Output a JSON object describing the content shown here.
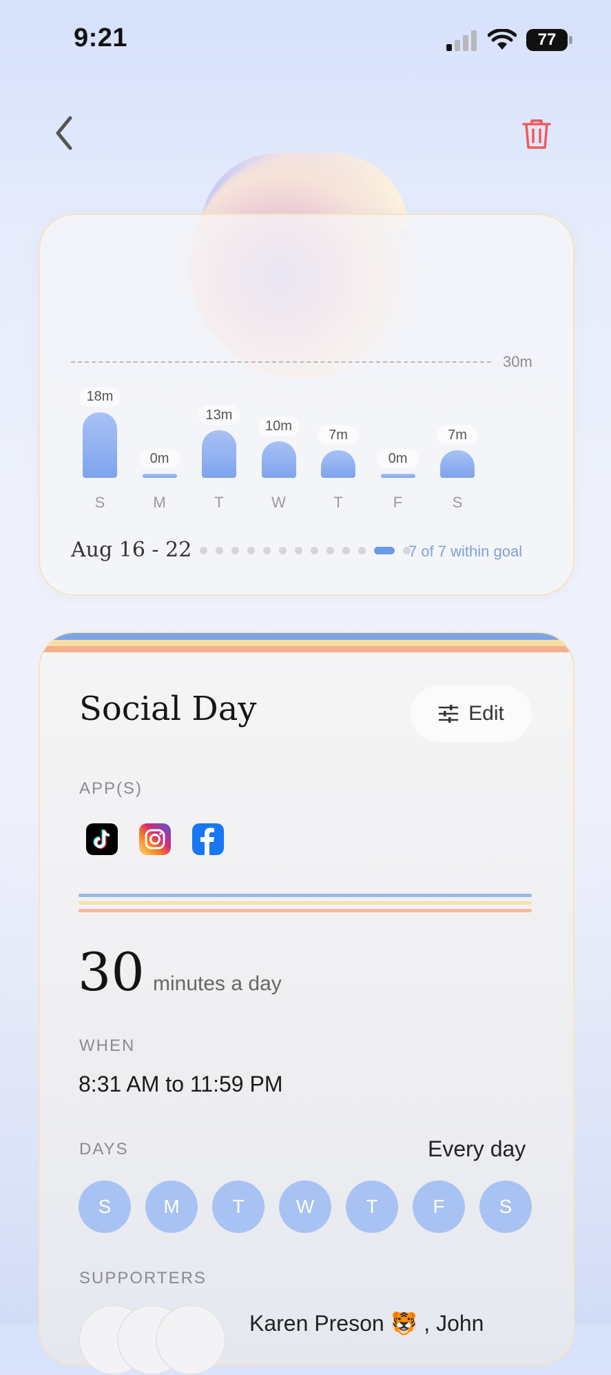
{
  "status_bar": {
    "time": "9:21",
    "battery": "77"
  },
  "chart_data": {
    "type": "bar",
    "categories": [
      "S",
      "M",
      "T",
      "W",
      "T",
      "F",
      "S"
    ],
    "values": [
      18,
      0,
      13,
      10,
      7,
      0,
      7
    ],
    "value_labels": [
      "18m",
      "0m",
      "13m",
      "10m",
      "7m",
      "0m",
      "7m"
    ],
    "goal_label": "30m",
    "goal_value": 30,
    "ylim": [
      0,
      30
    ]
  },
  "week": {
    "range": "Aug 16 - 22",
    "within_goal": "7 of 7 within goal",
    "page_count": 13,
    "active_page": 11
  },
  "limit": {
    "title": "Social Day",
    "edit_label": "Edit",
    "apps_label": "APP(S)",
    "apps": [
      "tiktok-icon",
      "instagram-icon",
      "facebook-icon"
    ],
    "minutes": "30",
    "minutes_unit": "minutes a day",
    "when_label": "WHEN",
    "when_value": "8:31 AM  to  11:59 PM",
    "days_label": "DAYS",
    "days_summary": "Every day",
    "days": [
      "S",
      "M",
      "T",
      "W",
      "T",
      "F",
      "S"
    ],
    "supporters_label": "SUPPORTERS",
    "supporter_names": "Karen Preson 🐯 , John"
  },
  "colors": {
    "accent_blue": "#7ea4ee",
    "stripe_blue": "#7ea4e6",
    "stripe_yellow": "#f7dfa4",
    "stripe_orange": "#f3b08c",
    "trash_red": "#ef5a5a"
  }
}
